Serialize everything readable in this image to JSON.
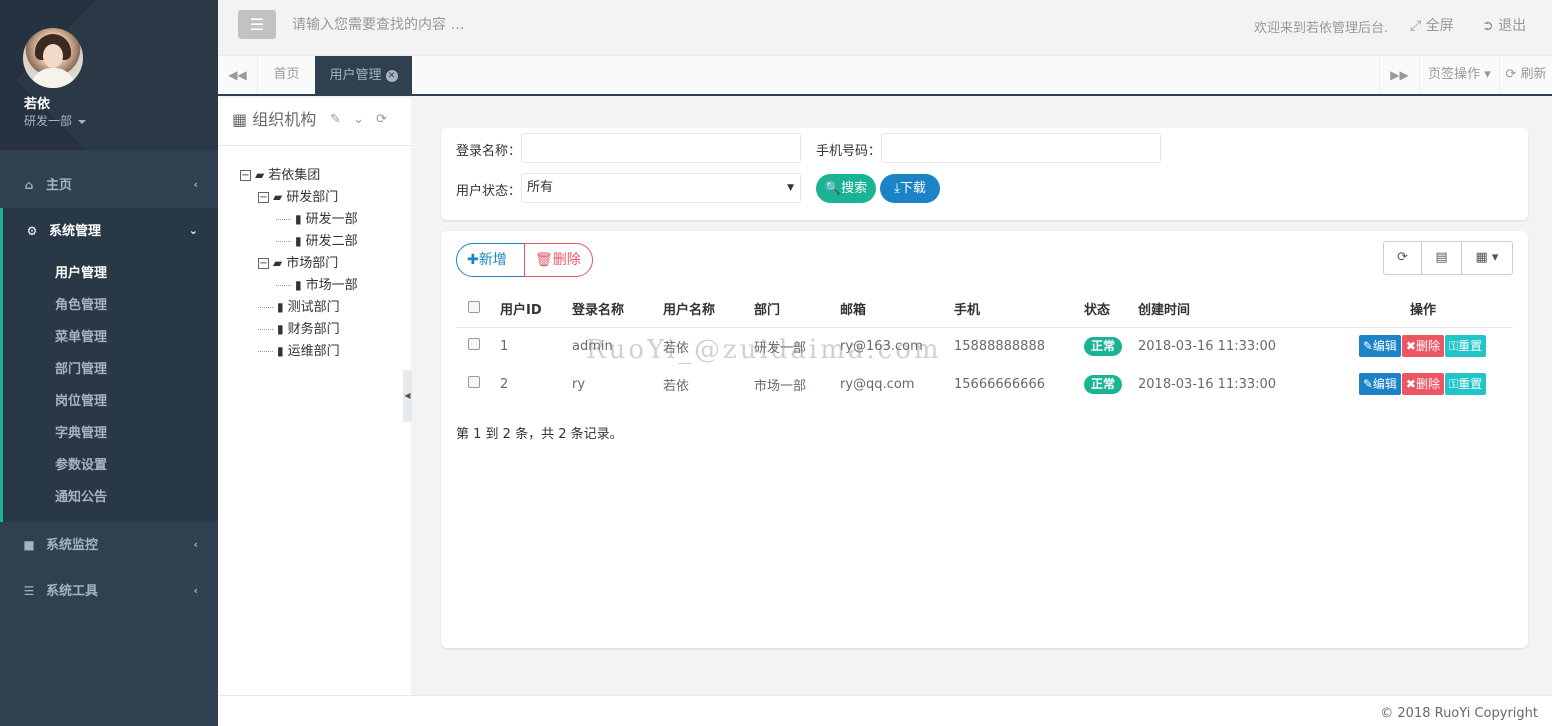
{
  "user": {
    "name": "若依",
    "dept": "研发一部"
  },
  "sidebar": {
    "items": [
      {
        "label": "主页",
        "icon": "home-icon"
      },
      {
        "label": "系统管理",
        "icon": "gear-icon"
      },
      {
        "label": "系统监控",
        "icon": "video-icon"
      },
      {
        "label": "系统工具",
        "icon": "bars-icon"
      }
    ],
    "submenu": [
      "用户管理",
      "角色管理",
      "菜单管理",
      "部门管理",
      "岗位管理",
      "字典管理",
      "参数设置",
      "通知公告"
    ]
  },
  "topbar": {
    "search_placeholder": "请输入您需要查找的内容 …",
    "welcome": "欢迎来到若依管理后台.",
    "fullscreen": "全屏",
    "logout": "退出"
  },
  "tabs": {
    "home": "首页",
    "active": "用户管理",
    "ops": "页签操作",
    "refresh": "刷新"
  },
  "org": {
    "title": "组织机构",
    "tree": [
      {
        "label": "若依集团",
        "level": 0,
        "type": "folder",
        "switch": "−"
      },
      {
        "label": "研发部门",
        "level": 1,
        "type": "folder",
        "switch": "−"
      },
      {
        "label": "研发一部",
        "level": 2,
        "type": "file"
      },
      {
        "label": "研发二部",
        "level": 2,
        "type": "file"
      },
      {
        "label": "市场部门",
        "level": 1,
        "type": "folder",
        "switch": "−"
      },
      {
        "label": "市场一部",
        "level": 2,
        "type": "file"
      },
      {
        "label": "测试部门",
        "level": 1,
        "type": "file"
      },
      {
        "label": "财务部门",
        "level": 1,
        "type": "file"
      },
      {
        "label": "运维部门",
        "level": 1,
        "type": "file"
      }
    ]
  },
  "search": {
    "login_label": "登录名称：",
    "phone_label": "手机号码：",
    "status_label": "用户状态：",
    "status_value": "所有",
    "search_btn": "搜索",
    "download_btn": "下载"
  },
  "toolbar": {
    "add": "新增",
    "delete": "删除"
  },
  "table": {
    "headers": [
      "用户ID",
      "登录名称",
      "用户名称",
      "部门",
      "邮箱",
      "手机",
      "状态",
      "创建时间",
      "操作"
    ],
    "rows": [
      {
        "id": "1",
        "login": "admin",
        "name": "若依",
        "dept": "研发一部",
        "email": "ry@163.com",
        "phone": "15888888888",
        "status": "正常",
        "created": "2018-03-16 11:33:00"
      },
      {
        "id": "2",
        "login": "ry",
        "name": "若依",
        "dept": "市场一部",
        "email": "ry@qq.com",
        "phone": "15666666666",
        "status": "正常",
        "created": "2018-03-16 11:33:00"
      }
    ],
    "actions": {
      "edit": "编辑",
      "remove": "删除",
      "reset": "重置"
    }
  },
  "pagination": "第 1 到 2 条，共 2 条记录。",
  "watermark": "RuoYi_@zuidaima.com",
  "footer": "© 2018 RuoYi Copyright",
  "colors": {
    "sidebar": "#2f4050",
    "accent": "#1ab394",
    "primary": "#1c84c6",
    "danger": "#ed5565",
    "info": "#23c6c8"
  }
}
